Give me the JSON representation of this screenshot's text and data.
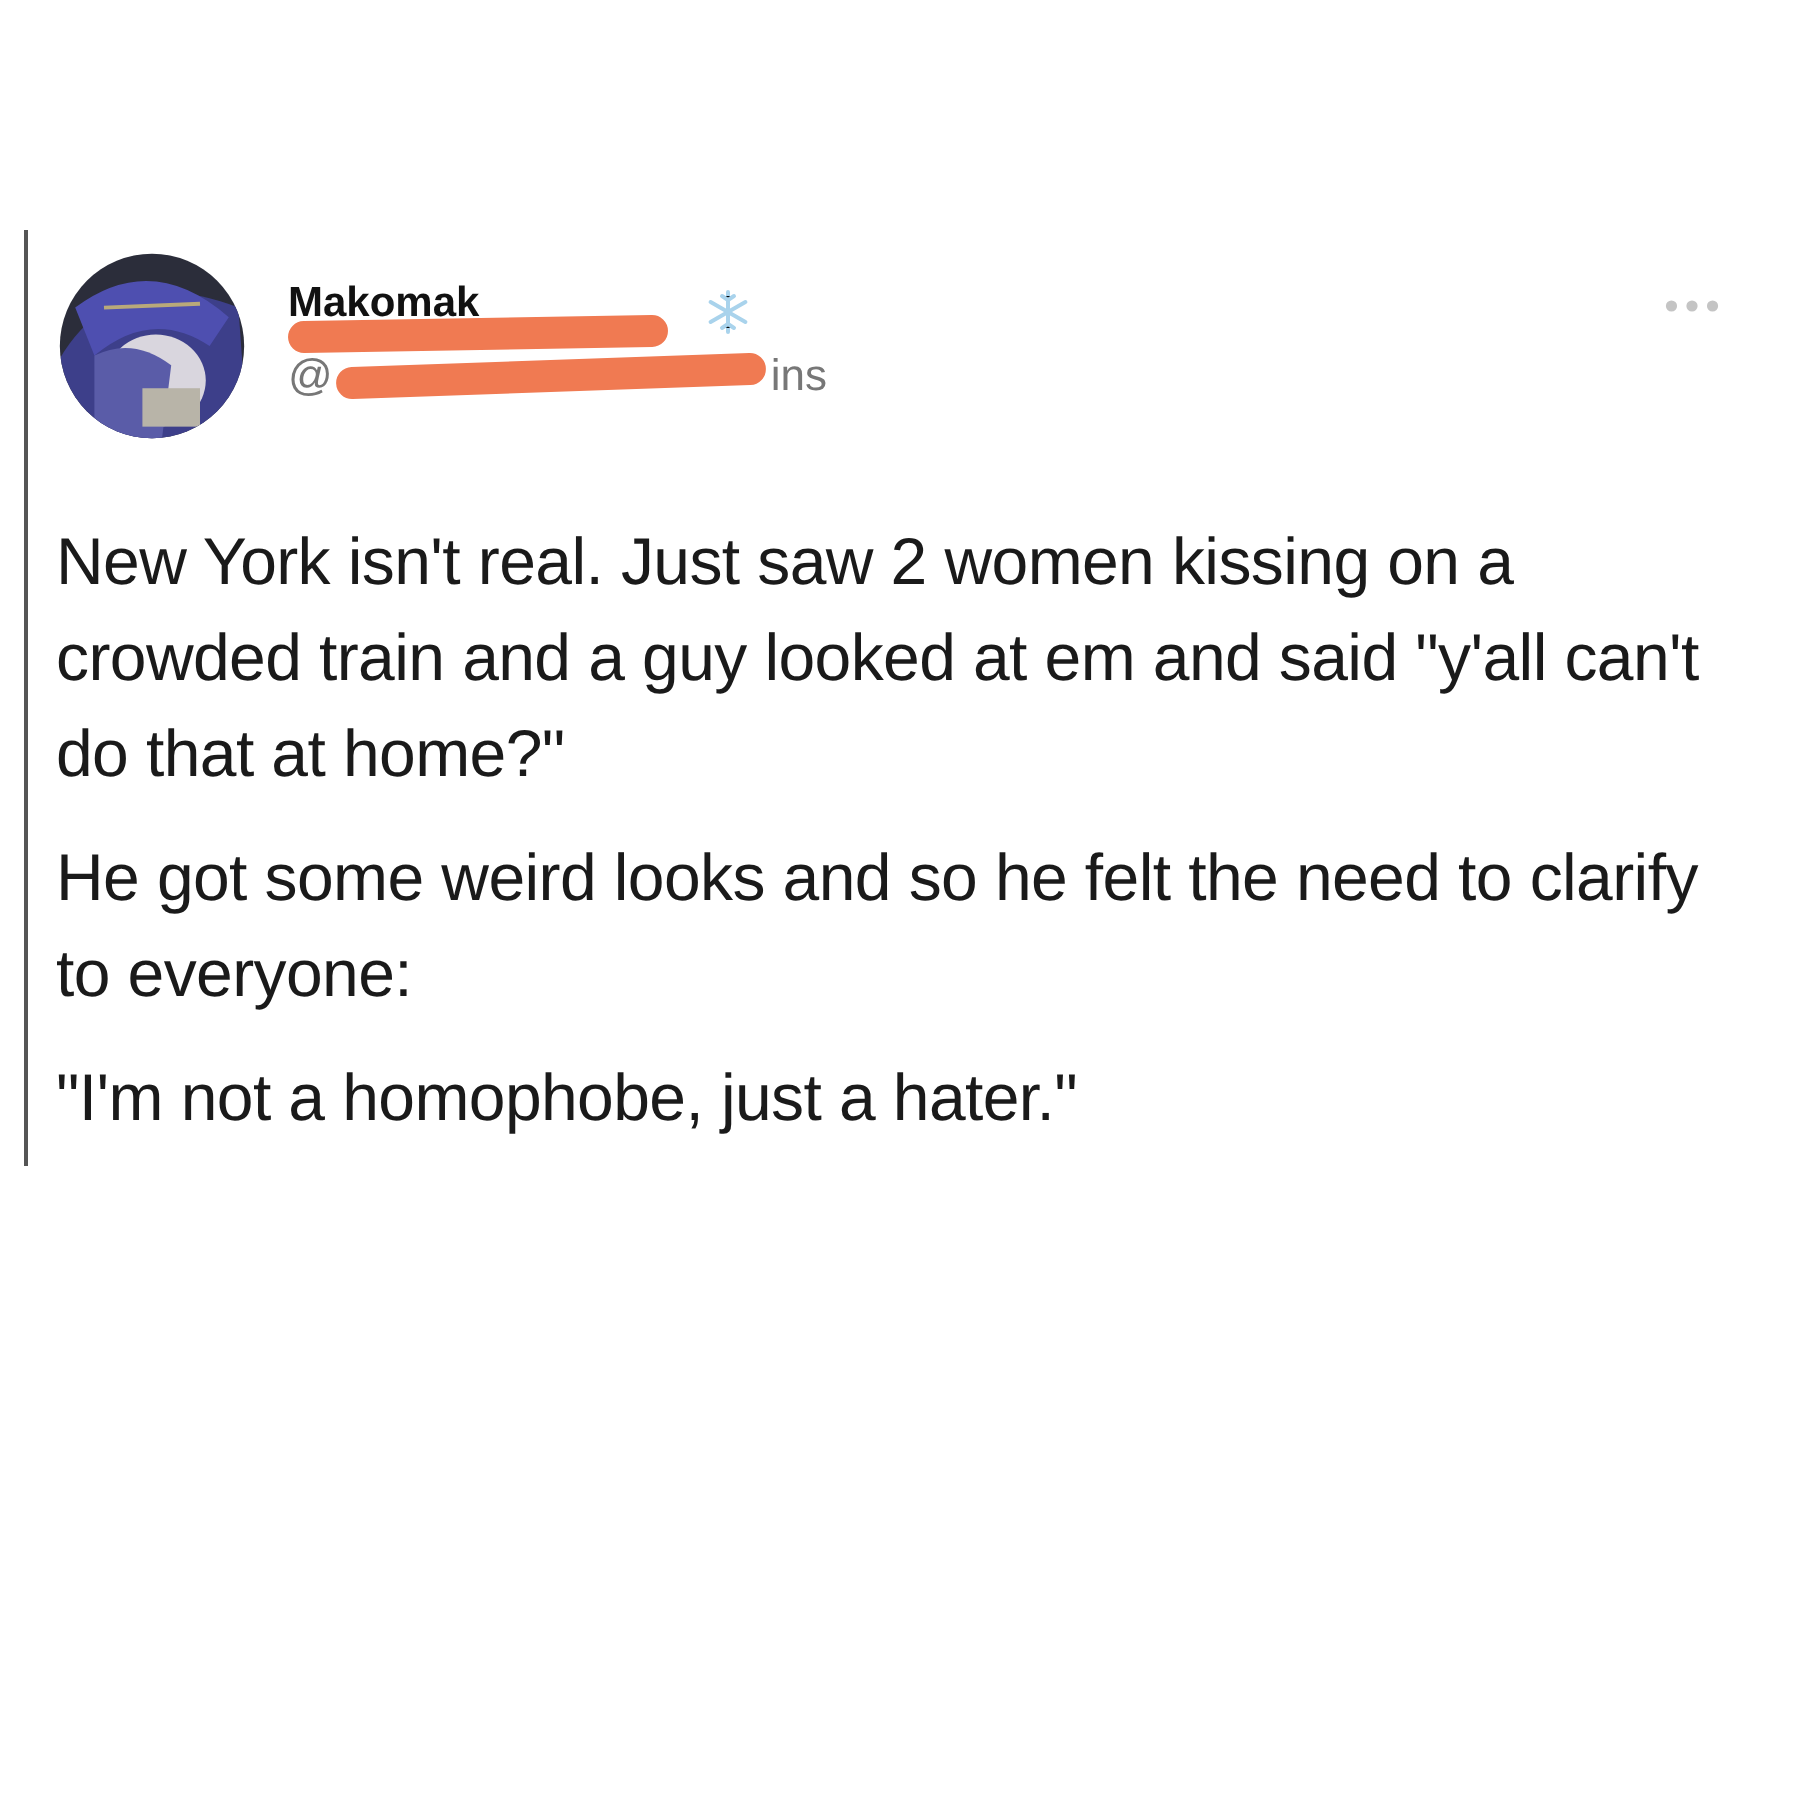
{
  "post": {
    "author": {
      "display_name": "Makomak",
      "handle_start": "@",
      "handle_end": "ins"
    },
    "paragraphs": [
      "New York isn't real. Just saw 2 women kissing on a crowded train and a guy looked at em and said \"y'all can't do that at home?\"",
      "He got some weird looks and so he felt the need to clarify to everyone:",
      "\"I'm not a homophobe, just a hater.\""
    ]
  }
}
